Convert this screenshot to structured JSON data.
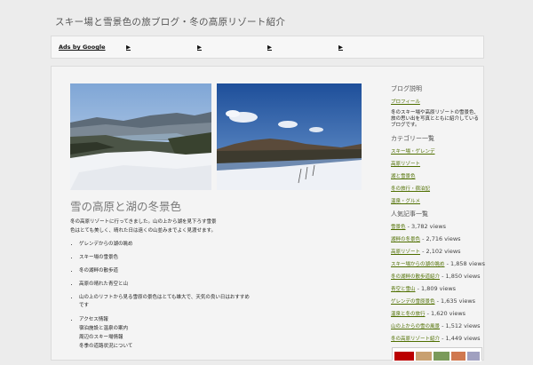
{
  "site": {
    "title": "スキー場と雪景色の旅ブログ・冬の高原リゾート紹介"
  },
  "ads": {
    "label": "Ads by Google",
    "links": [
      "▶",
      "▶",
      "▶",
      "▶"
    ]
  },
  "post": {
    "title": "雪の高原と湖の冬景色",
    "intro": "冬の高原リゾートに行ってきました。山の上から湖を見下ろす雪景色はとても美しく、晴れた日は遠くの山並みまでよく見渡せます。",
    "bullets": [
      "ゲレンデからの湖の眺め",
      "スキー場の雪景色",
      "冬の湖畔の散歩道",
      "高原の晴れた青空と山",
      "山の上のリフトから見る雪原の景色はとても雄大で、天気の良い日はおすすめです",
      "アクセス情報\n宿泊施設と温泉の案内\n周辺のスキー場情報\n冬季の道路状況について"
    ]
  },
  "sidebar": {
    "about_title": "ブログ説明",
    "about_link": "プロフィール",
    "about_text": "冬のスキー場や高原リゾートの雪景色、旅の思い出を写真とともに紹介しているブログです。",
    "categories_title": "カテゴリー一覧",
    "categories": [
      "スキー場・ゲレンデ",
      "高原リゾート",
      "湖と雪景色",
      "冬の旅行・宿泊記",
      "温泉・グルメ"
    ],
    "popular_title": "人気記事一覧",
    "popular": [
      {
        "title": "雪景色",
        "views": "- 3,782 views"
      },
      {
        "title": "湖畔の冬景色",
        "views": "- 2,716 views"
      },
      {
        "title": "高原リゾート",
        "views": "- 2,102 views"
      },
      {
        "title": "スキー場からの湖の眺め",
        "views": "- 1,858 views"
      },
      {
        "title": "冬の湖畔の散歩道紹介",
        "views": "- 1,850 views"
      },
      {
        "title": "青空と雪山",
        "views": "- 1,809 views"
      },
      {
        "title": "ゲレンデの雪原景色",
        "views": "- 1,635 views"
      },
      {
        "title": "温泉と冬の旅行",
        "views": "- 1,620 views"
      },
      {
        "title": "山の上からの雪の風景",
        "views": "- 1,512 views"
      },
      {
        "title": "冬の高原リゾート紹介",
        "views": "- 1,449 views"
      }
    ]
  },
  "colors": {
    "link": "#4f6f00",
    "background": "#ececec",
    "panel": "#f4f4f4"
  }
}
